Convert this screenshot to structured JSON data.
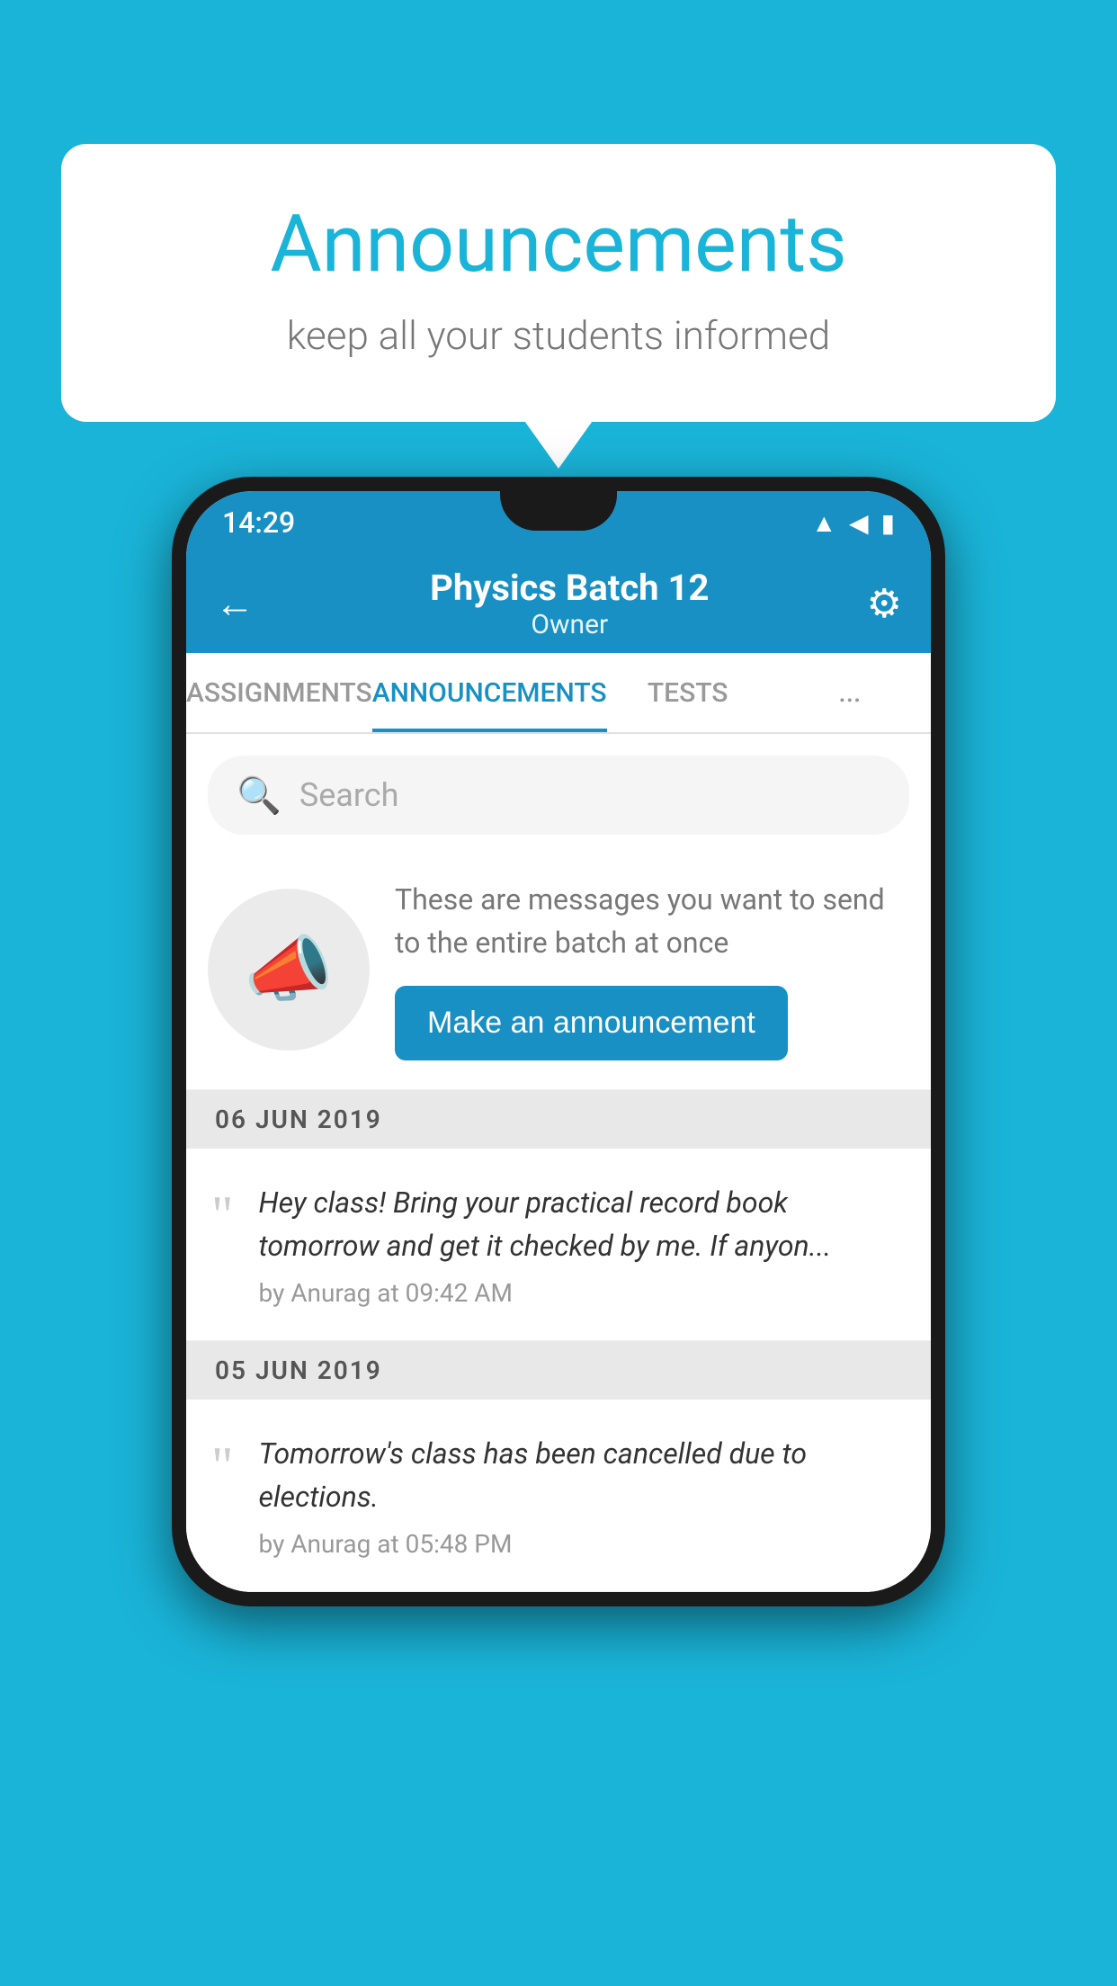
{
  "background_color": "#1ab4d8",
  "speech_bubble": {
    "title": "Announcements",
    "subtitle": "keep all your students informed"
  },
  "status_bar": {
    "time": "14:29",
    "wifi": "▲",
    "signal": "◀",
    "battery": "▮"
  },
  "app_bar": {
    "back_label": "←",
    "title": "Physics Batch 12",
    "subtitle": "Owner",
    "settings_label": "⚙"
  },
  "tabs": [
    {
      "label": "ASSIGNMENTS",
      "active": false
    },
    {
      "label": "ANNOUNCEMENTS",
      "active": true
    },
    {
      "label": "TESTS",
      "active": false
    },
    {
      "label": "...",
      "active": false
    }
  ],
  "search": {
    "placeholder": "Search",
    "icon": "🔍"
  },
  "announcement_prompt": {
    "description": "These are messages you want to send to the entire batch at once",
    "button_label": "Make an announcement"
  },
  "date_groups": [
    {
      "date": "06  JUN  2019",
      "items": [
        {
          "text": "Hey class! Bring your practical record book tomorrow and get it checked by me. If anyon...",
          "author": "by Anurag at 09:42 AM"
        }
      ]
    },
    {
      "date": "05  JUN  2019",
      "items": [
        {
          "text": "Tomorrow's class has been cancelled due to elections.",
          "author": "by Anurag at 05:48 PM"
        }
      ]
    }
  ]
}
